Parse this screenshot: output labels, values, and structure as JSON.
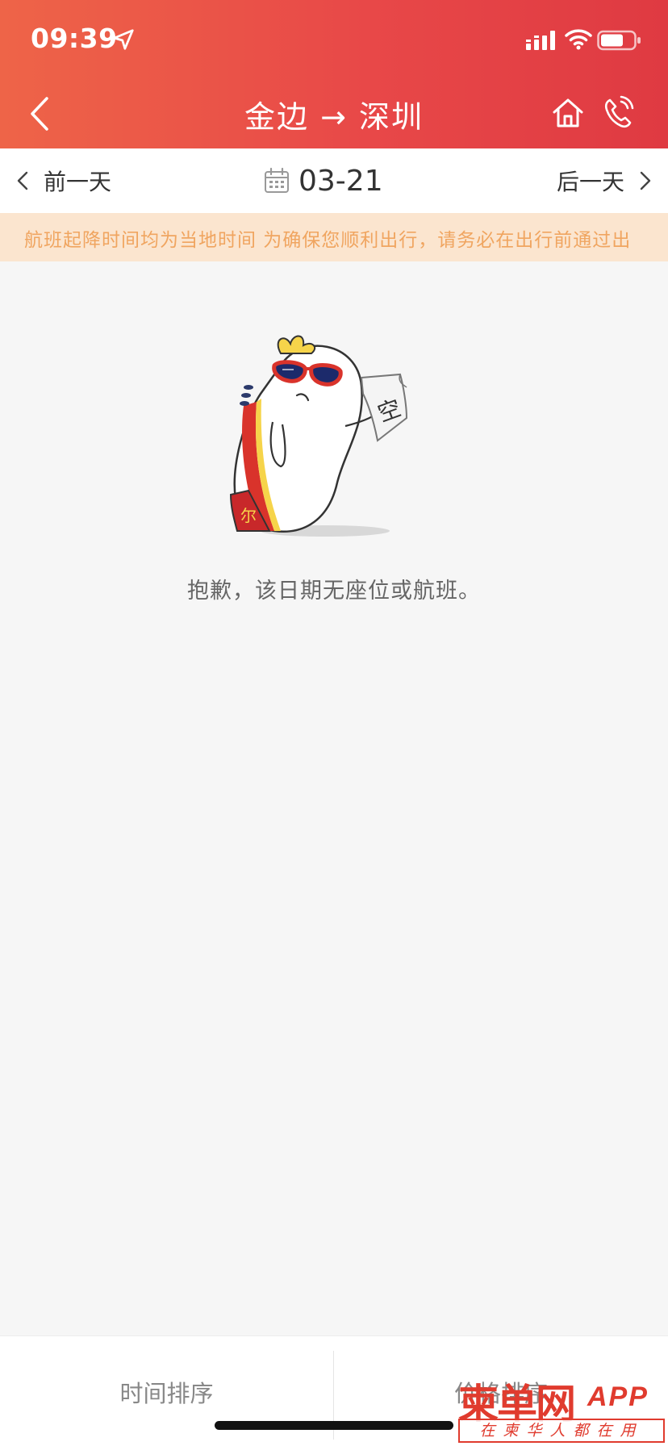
{
  "status_bar": {
    "time": "09:39",
    "icons": [
      "location-arrow-icon",
      "signal-icon",
      "wifi-icon",
      "battery-icon"
    ]
  },
  "nav": {
    "title": "金边 → 深圳",
    "back_icon": "back-chevron-icon",
    "home_icon": "home-icon",
    "phone_icon": "phone-icon"
  },
  "date_bar": {
    "prev_label": "前一天",
    "date": "03-21",
    "next_label": "后一天",
    "calendar_icon": "calendar-icon"
  },
  "notice": {
    "text": "航班起降时间均为当地时间  为确保您顺利出行，请务必在出行前通过出"
  },
  "empty_state": {
    "mascot_sign": "空",
    "message": "抱歉，该日期无座位或航班。"
  },
  "bottom_bar": {
    "sort_time": "时间排序",
    "sort_price": "价格排序"
  },
  "watermark": {
    "main": "柬单网",
    "app": "APP",
    "tagline": "在柬华人都在用"
  },
  "colors": {
    "header_start": "#ee6448",
    "header_end": "#df3a42",
    "notice_bg": "#fbe5cf",
    "notice_text": "#f0a560",
    "page_bg": "#f6f6f6"
  }
}
